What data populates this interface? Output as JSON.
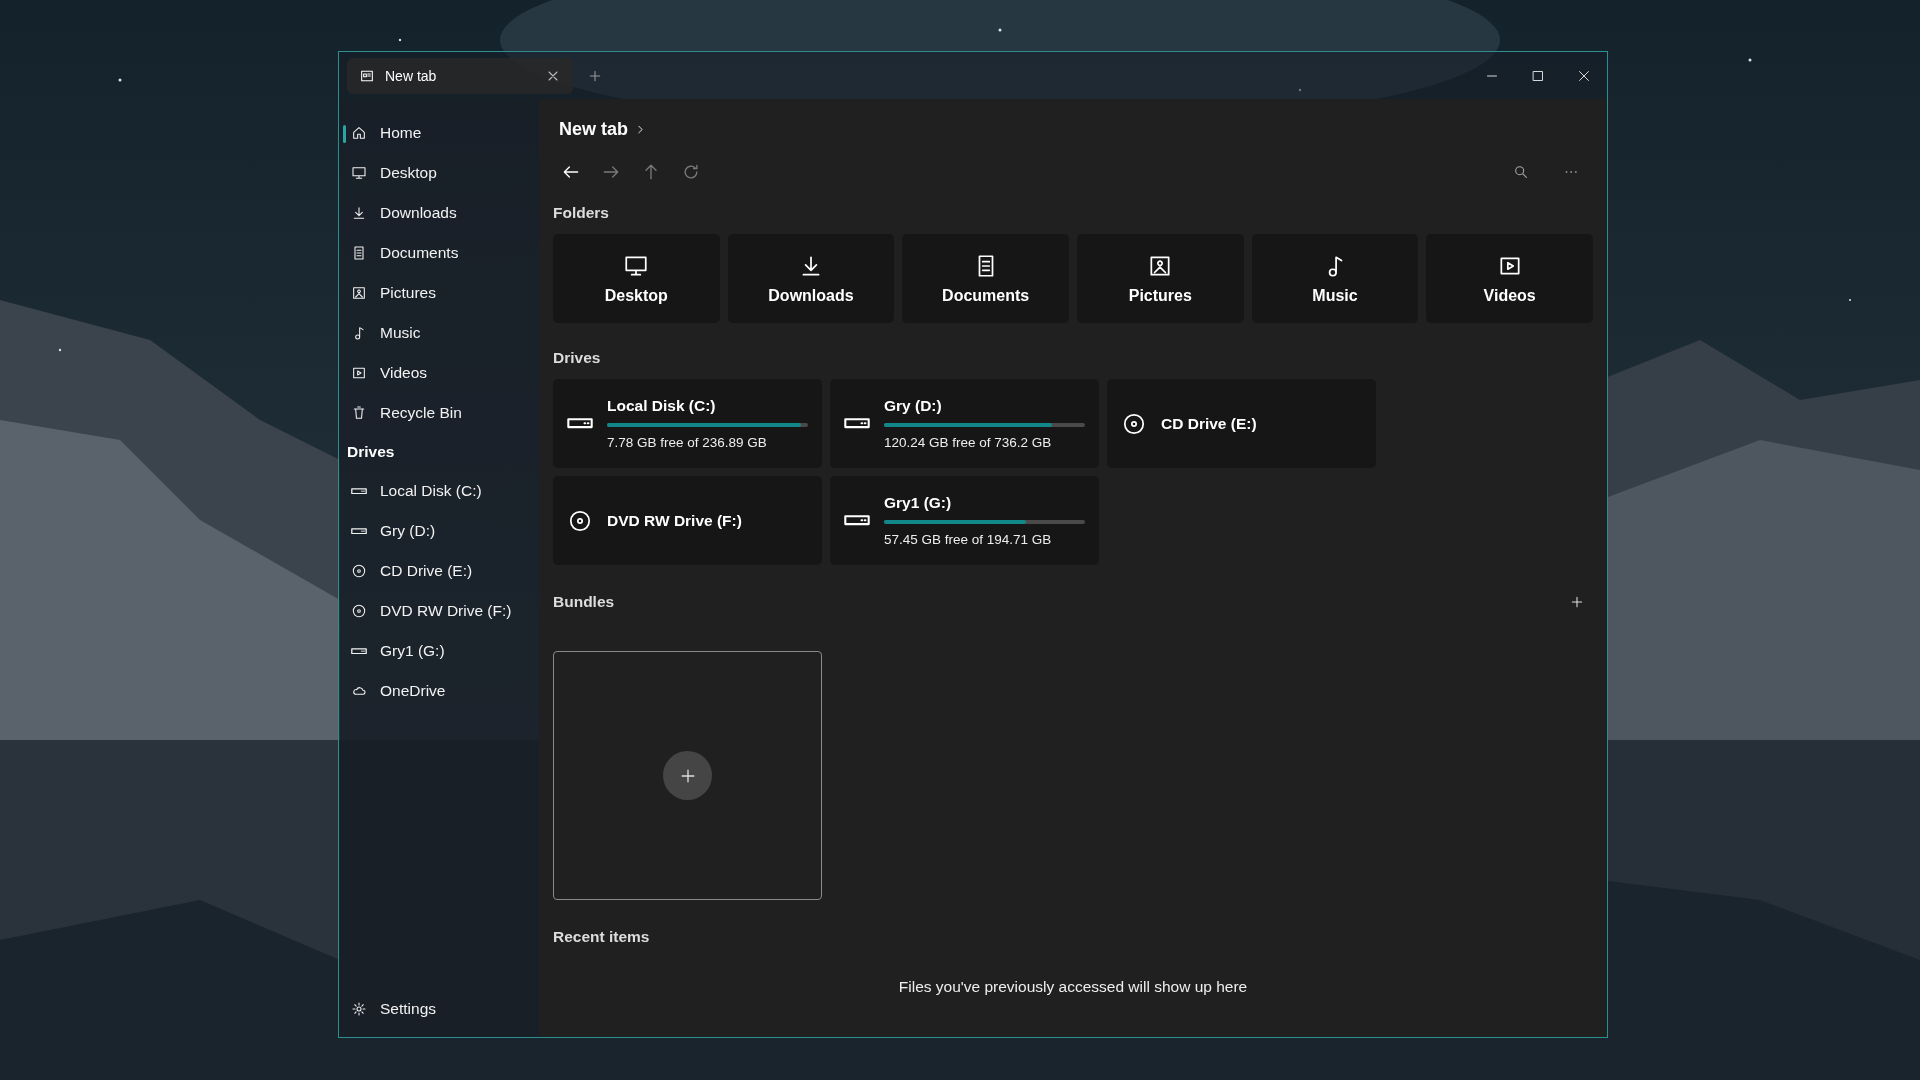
{
  "window": {
    "tabs": [
      {
        "label": "New tab",
        "selected": true
      }
    ]
  },
  "sidebar": {
    "items": [
      {
        "label": "Home",
        "kind": "home",
        "selected": true
      },
      {
        "label": "Desktop",
        "kind": "desktop",
        "selected": false
      },
      {
        "label": "Downloads",
        "kind": "downloads",
        "selected": false
      },
      {
        "label": "Documents",
        "kind": "documents",
        "selected": false
      },
      {
        "label": "Pictures",
        "kind": "pictures",
        "selected": false
      },
      {
        "label": "Music",
        "kind": "music",
        "selected": false
      },
      {
        "label": "Videos",
        "kind": "videos",
        "selected": false
      },
      {
        "label": "Recycle Bin",
        "kind": "recycle",
        "selected": false
      }
    ],
    "drives_heading": "Drives",
    "drives": [
      {
        "label": "Local Disk (C:)",
        "kind": "disk",
        "selected": false
      },
      {
        "label": "Gry (D:)",
        "kind": "disk",
        "selected": false
      },
      {
        "label": "CD Drive (E:)",
        "kind": "optical",
        "selected": false
      },
      {
        "label": "DVD RW Drive (F:)",
        "kind": "optical",
        "selected": false
      },
      {
        "label": "Gry1 (G:)",
        "kind": "disk",
        "selected": false
      },
      {
        "label": "OneDrive",
        "kind": "cloud",
        "selected": false
      }
    ],
    "settings": {
      "label": "Settings",
      "kind": "settings"
    }
  },
  "main": {
    "breadcrumb": [
      "New tab"
    ],
    "nav": [
      {
        "kind": "back",
        "disabled": false
      },
      {
        "kind": "forward",
        "disabled": true
      },
      {
        "kind": "up",
        "disabled": true
      },
      {
        "kind": "refresh",
        "disabled": true
      }
    ],
    "folders_heading": "Folders",
    "folders": [
      {
        "label": "Desktop",
        "kind": "desktop"
      },
      {
        "label": "Downloads",
        "kind": "downloads"
      },
      {
        "label": "Documents",
        "kind": "documents"
      },
      {
        "label": "Pictures",
        "kind": "pictures"
      },
      {
        "label": "Music",
        "kind": "music"
      },
      {
        "label": "Videos",
        "kind": "videos"
      }
    ],
    "drives_heading": "Drives",
    "drives": [
      {
        "name": "Local Disk (C:)",
        "kind": "disk",
        "level": 0.967,
        "free": "7.78 GB free of 236.89 GB"
      },
      {
        "name": "Gry (D:)",
        "kind": "disk",
        "level": 0.837,
        "free": "120.24 GB free of 736.2 GB"
      },
      {
        "name": "CD Drive (E:)",
        "kind": "optical"
      },
      {
        "name": "DVD RW Drive (F:)",
        "kind": "optical"
      },
      {
        "name": "Gry1 (G:)",
        "kind": "disk",
        "level": 0.705,
        "free": "57.45 GB free of 194.71 GB"
      }
    ],
    "bundles_heading": "Bundles",
    "recent_heading": "Recent items",
    "recent_empty": "Files you've previously accessed will show up here"
  }
}
